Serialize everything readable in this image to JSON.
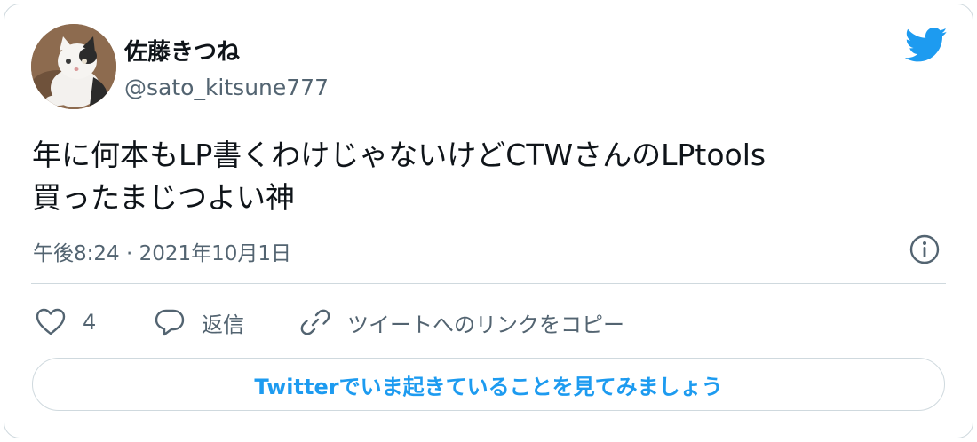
{
  "author": {
    "display_name": "佐藤きつね",
    "handle": "@sato_kitsune777"
  },
  "tweet": {
    "text_line1": "年に何本もLP書くわけじゃないけどCTWさんのLPtools",
    "text_line2": "買ったまじつよい神",
    "timestamp": "午後8:24 · 2021年10月1日"
  },
  "actions": {
    "like_count": "4",
    "reply_label": "返信",
    "copy_link_label": "ツイートへのリンクをコピー"
  },
  "cta": {
    "label": "Twitterでいま起きていることを見てみましょう"
  },
  "colors": {
    "accent": "#1d9bf0",
    "text_primary": "#0f1419",
    "text_secondary": "#536471",
    "border": "#cfd9de"
  },
  "icons": {
    "brand": "twitter-bird-icon",
    "info": "info-icon",
    "like": "heart-icon",
    "reply": "speech-bubble-icon",
    "copy_link": "link-icon"
  }
}
